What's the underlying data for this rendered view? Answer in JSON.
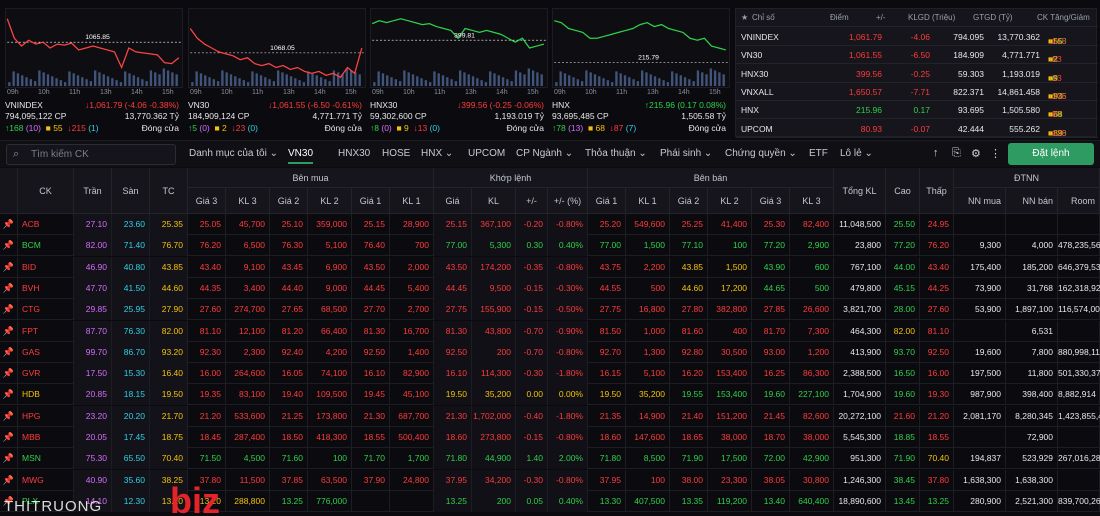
{
  "minis": [
    {
      "name": "VNINDEX",
      "line_color": "#ff4444",
      "ref_label": "1065.85",
      "change": "↓1,061.79 (-4.06 -0.38%)",
      "change_color": "#ff3b3b",
      "vol": "794,095,122 CP",
      "val": "13,770.362 Tỷ",
      "up": "↑168",
      "up_ceil": "(10)",
      "ref_cnt": "55",
      "down": "↓215",
      "down_floor": "(1)",
      "status": "Đóng cửa"
    },
    {
      "name": "VN30",
      "line_color": "#ff4444",
      "ref_label": "1068.05",
      "change": "↓1,061.55 (-6.50 -0.61%)",
      "change_color": "#ff3b3b",
      "vol": "184,909,124 CP",
      "val": "4,771.771 Tỷ",
      "up": "↑5",
      "up_ceil": "(0)",
      "ref_cnt": "2",
      "down": "↓23",
      "down_floor": "(0)",
      "status": "Đóng cửa"
    },
    {
      "name": "HNX30",
      "line_color": "#2fd14b",
      "ref_label": "399.81",
      "change": "↓399.56 (-0.25 -0.06%)",
      "change_color": "#ff3b3b",
      "vol": "59,302,600 CP",
      "val": "1,193.019 Tỷ",
      "up": "↑8",
      "up_ceil": "(0)",
      "ref_cnt": "9",
      "down": "↓13",
      "down_floor": "(0)",
      "status": "Đóng cửa"
    },
    {
      "name": "HNX",
      "line_color": "#2fd14b",
      "ref_label": "215.79",
      "change": "↑215.96 (0.17 0.08%)",
      "change_color": "#2fd14b",
      "vol": "93,695,485 CP",
      "val": "1,505.58 Tỷ",
      "up": "↑78",
      "up_ceil": "(13)",
      "ref_cnt": "68",
      "down": "↓87",
      "down_floor": "(7)",
      "status": "Đóng cửa"
    }
  ],
  "mini_times": [
    "09h",
    "10h",
    "11h",
    "13h",
    "14h",
    "15h"
  ],
  "index_table": {
    "headers": [
      "Chỉ số",
      "Điểm",
      "+/-",
      "KLGD (Triệu)",
      "GTGD (Tỷ)",
      "CK Tăng/Giảm"
    ],
    "rows": [
      {
        "name": "VNINDEX",
        "point": "1,061.79",
        "change": "-4.06",
        "vol": "794.095",
        "val": "13,770.362",
        "up": "↑168",
        "ref": "55",
        "down": "↓215",
        "color": "#ff3b3b"
      },
      {
        "name": "VN30",
        "point": "1,061.55",
        "change": "-6.50",
        "vol": "184.909",
        "val": "4,771.771",
        "up": "↑5",
        "ref": "2",
        "down": "↓23",
        "color": "#ff3b3b"
      },
      {
        "name": "HNX30",
        "point": "399.56",
        "change": "-0.25",
        "vol": "59.303",
        "val": "1,193.019",
        "up": "↑8",
        "ref": "9",
        "down": "↓13",
        "color": "#ff3b3b"
      },
      {
        "name": "VNXALL",
        "point": "1,650.57",
        "change": "-7.71",
        "vol": "822.371",
        "val": "14,861.458",
        "up": "↑175",
        "ref": "93",
        "down": "↓206",
        "color": "#ff3b3b"
      },
      {
        "name": "HNX",
        "point": "215.96",
        "change": "0.17",
        "vol": "93.695",
        "val": "1,505.580",
        "up": "↑78",
        "ref": "68",
        "down": "↓87",
        "color": "#2fd14b"
      },
      {
        "name": "UPCOM",
        "point": "80.93",
        "change": "-0.07",
        "vol": "42.444",
        "val": "555.262",
        "up": "↑128",
        "ref": "89",
        "down": "↓130",
        "color": "#ff3b3b"
      }
    ]
  },
  "toolbar": {
    "search_placeholder": "Tìm kiếm CK",
    "tabs": [
      "Danh mục của tôi",
      "VN30",
      "HNX30",
      "HOSE",
      "HNX",
      "UPCOM",
      "CP Ngành",
      "Thỏa thuận",
      "Phái sinh",
      "Chứng quyền",
      "ETF",
      "Lô lẻ"
    ],
    "order_label": "Đặt lệnh"
  },
  "board": {
    "groups": {
      "buy": "Bên mua",
      "match": "Khớp lệnh",
      "sell": "Bên bán",
      "foreign": "ĐTNN"
    },
    "headers": {
      "ck": "CK",
      "ceil": "Trần",
      "floor": "Sàn",
      "ref": "TC",
      "b3": "Giá 3",
      "bk3": "KL 3",
      "b2": "Giá 2",
      "bk2": "KL 2",
      "b1": "Giá 1",
      "bk1": "KL 1",
      "mp": "Giá",
      "mk": "KL",
      "mc": "+/-",
      "mpct": "+/- (%)",
      "s1": "Giá 1",
      "sk1": "KL 1",
      "s2": "Giá 2",
      "sk2": "KL 2",
      "s3": "Giá 3",
      "sk3": "KL 3",
      "tot": "Tổng KL",
      "hi": "Cao",
      "lo": "Thấp",
      "nnb": "NN mua",
      "nns": "NN bán",
      "room": "Room"
    },
    "rows": [
      {
        "ck": "ACB",
        "ck_c": "#ff3b3b",
        "ceil": "27.10",
        "floor": "23.60",
        "ref": "25.35",
        "b3": "25.05",
        "b3c": "#ff3b3b",
        "bk3": "45,700",
        "b2": "25.10",
        "b2c": "#ff3b3b",
        "bk2": "359,000",
        "b1": "25.15",
        "b1c": "#ff3b3b",
        "bk1": "28,900",
        "mp": "25.15",
        "mpc": "#ff3b3b",
        "mk": "367,100",
        "mc": "-0.20",
        "mpct": "-0.80%",
        "s1": "25.20",
        "s1c": "#ff3b3b",
        "sk1": "549,600",
        "s2": "25.25",
        "s2c": "#ff3b3b",
        "sk2": "41,400",
        "s3": "25.30",
        "s3c": "#ff3b3b",
        "sk3": "82,400",
        "tot": "11,048,500",
        "hi": "25.50",
        "hic": "#2fd14b",
        "lo": "24.95",
        "loc": "#ff3b3b",
        "nnb": "",
        "nns": "",
        "room": ""
      },
      {
        "ck": "BCM",
        "ck_c": "#2fd14b",
        "ceil": "82.00",
        "floor": "71.40",
        "ref": "76.70",
        "b3": "76.20",
        "b3c": "#ff3b3b",
        "bk3": "6,500",
        "b2": "76.30",
        "b2c": "#ff3b3b",
        "bk2": "5,100",
        "b1": "76.40",
        "b1c": "#ff3b3b",
        "bk1": "700",
        "mp": "77.00",
        "mpc": "#2fd14b",
        "mk": "5,300",
        "mc": "0.30",
        "mpct": "0.40%",
        "s1": "77.00",
        "s1c": "#2fd14b",
        "sk1": "1,500",
        "s2": "77.10",
        "s2c": "#2fd14b",
        "sk2": "100",
        "s3": "77.20",
        "s3c": "#2fd14b",
        "sk3": "2,900",
        "tot": "23,800",
        "hi": "77.20",
        "hic": "#2fd14b",
        "lo": "76.20",
        "loc": "#ff3b3b",
        "nnb": "9,300",
        "nns": "4,000",
        "room": "478,235,565"
      },
      {
        "ck": "BID",
        "ck_c": "#ff3b3b",
        "ceil": "46.90",
        "floor": "40.80",
        "ref": "43.85",
        "b3": "43.40",
        "b3c": "#ff3b3b",
        "bk3": "9,100",
        "b2": "43.45",
        "b2c": "#ff3b3b",
        "bk2": "6,900",
        "b1": "43.50",
        "b1c": "#ff3b3b",
        "bk1": "2,000",
        "mp": "43.50",
        "mpc": "#ff3b3b",
        "mk": "174,200",
        "mc": "-0.35",
        "mpct": "-0.80%",
        "s1": "43.75",
        "s1c": "#ff3b3b",
        "sk1": "2,200",
        "s2": "43.85",
        "s2c": "#f4c20d",
        "sk2": "1,500",
        "s3": "43.90",
        "s3c": "#2fd14b",
        "sk3": "600",
        "tot": "767,100",
        "hi": "44.00",
        "hic": "#2fd14b",
        "lo": "43.40",
        "loc": "#ff3b3b",
        "nnb": "175,400",
        "nns": "185,200",
        "room": "646,379,531"
      },
      {
        "ck": "BVH",
        "ck_c": "#ff3b3b",
        "ceil": "47.70",
        "floor": "41.50",
        "ref": "44.60",
        "b3": "44.35",
        "b3c": "#ff3b3b",
        "bk3": "3,400",
        "b2": "44.40",
        "b2c": "#ff3b3b",
        "bk2": "9,000",
        "b1": "44.45",
        "b1c": "#ff3b3b",
        "bk1": "5,400",
        "mp": "44.45",
        "mpc": "#ff3b3b",
        "mk": "9,500",
        "mc": "-0.15",
        "mpct": "-0.30%",
        "s1": "44.55",
        "s1c": "#ff3b3b",
        "sk1": "500",
        "s2": "44.60",
        "s2c": "#f4c20d",
        "sk2": "17,200",
        "s3": "44.65",
        "s3c": "#2fd14b",
        "sk3": "500",
        "tot": "479,800",
        "hi": "45.15",
        "hic": "#2fd14b",
        "lo": "44.25",
        "loc": "#ff3b3b",
        "nnb": "73,900",
        "nns": "31,768",
        "room": "162,318,920"
      },
      {
        "ck": "CTG",
        "ck_c": "#ff3b3b",
        "ceil": "29.85",
        "floor": "25.95",
        "ref": "27.90",
        "b3": "27.60",
        "b3c": "#ff3b3b",
        "bk3": "274,700",
        "b2": "27.65",
        "b2c": "#ff3b3b",
        "bk2": "68,500",
        "b1": "27.70",
        "b1c": "#ff3b3b",
        "bk1": "2,700",
        "mp": "27.75",
        "mpc": "#ff3b3b",
        "mk": "155,900",
        "mc": "-0.15",
        "mpct": "-0.50%",
        "s1": "27.75",
        "s1c": "#ff3b3b",
        "sk1": "16,800",
        "s2": "27.80",
        "s2c": "#ff3b3b",
        "sk2": "382,800",
        "s3": "27.85",
        "s3c": "#ff3b3b",
        "sk3": "26,600",
        "tot": "3,821,700",
        "hi": "28.00",
        "hic": "#2fd14b",
        "lo": "27.60",
        "loc": "#ff3b3b",
        "nnb": "53,900",
        "nns": "1,897,100",
        "room": "116,574,005"
      },
      {
        "ck": "FPT",
        "ck_c": "#ff3b3b",
        "ceil": "87.70",
        "floor": "76.30",
        "ref": "82.00",
        "b3": "81.10",
        "b3c": "#ff3b3b",
        "bk3": "12,100",
        "b2": "81.20",
        "b2c": "#ff3b3b",
        "bk2": "66,400",
        "b1": "81.30",
        "b1c": "#ff3b3b",
        "bk1": "16,700",
        "mp": "81.30",
        "mpc": "#ff3b3b",
        "mk": "43,800",
        "mc": "-0.70",
        "mpct": "-0.90%",
        "s1": "81.50",
        "s1c": "#ff3b3b",
        "sk1": "1,000",
        "s2": "81.60",
        "s2c": "#ff3b3b",
        "sk2": "400",
        "s3": "81.70",
        "s3c": "#ff3b3b",
        "sk3": "7,300",
        "tot": "464,300",
        "hi": "82.00",
        "hic": "#f4c20d",
        "lo": "81.10",
        "loc": "#ff3b3b",
        "nnb": "",
        "nns": "6,531",
        "room": ""
      },
      {
        "ck": "GAS",
        "ck_c": "#ff3b3b",
        "ceil": "99.70",
        "floor": "86.70",
        "ref": "93.20",
        "b3": "92.30",
        "b3c": "#ff3b3b",
        "bk3": "2,300",
        "b2": "92.40",
        "b2c": "#ff3b3b",
        "bk2": "4,200",
        "b1": "92.50",
        "b1c": "#ff3b3b",
        "bk1": "1,400",
        "mp": "92.50",
        "mpc": "#ff3b3b",
        "mk": "200",
        "mc": "-0.70",
        "mpct": "-0.80%",
        "s1": "92.70",
        "s1c": "#ff3b3b",
        "sk1": "1,300",
        "s2": "92.80",
        "s2c": "#ff3b3b",
        "sk2": "30,500",
        "s3": "93.00",
        "s3c": "#ff3b3b",
        "sk3": "1,200",
        "tot": "413,900",
        "hi": "93.70",
        "hic": "#2fd14b",
        "lo": "92.50",
        "loc": "#ff3b3b",
        "nnb": "19,600",
        "nns": "7,800",
        "room": "880,998,111"
      },
      {
        "ck": "GVR",
        "ck_c": "#ff3b3b",
        "ceil": "17.50",
        "floor": "15.30",
        "ref": "16.40",
        "b3": "16.00",
        "b3c": "#ff3b3b",
        "bk3": "264,600",
        "b2": "16.05",
        "b2c": "#ff3b3b",
        "bk2": "74,100",
        "b1": "16.10",
        "b1c": "#ff3b3b",
        "bk1": "82,900",
        "mp": "16.10",
        "mpc": "#ff3b3b",
        "mk": "114,300",
        "mc": "-0.30",
        "mpct": "-1.80%",
        "s1": "16.15",
        "s1c": "#ff3b3b",
        "sk1": "5,100",
        "s2": "16.20",
        "s2c": "#ff3b3b",
        "sk2": "153,400",
        "s3": "16.25",
        "s3c": "#ff3b3b",
        "sk3": "86,300",
        "tot": "2,388,500",
        "hi": "16.50",
        "hic": "#2fd14b",
        "lo": "16.00",
        "loc": "#ff3b3b",
        "nnb": "197,500",
        "nns": "11,800",
        "room": "501,330,375"
      },
      {
        "ck": "HDB",
        "ck_c": "#f4c20d",
        "ceil": "20.85",
        "floor": "18.15",
        "ref": "19.50",
        "b3": "19.35",
        "b3c": "#ff3b3b",
        "bk3": "83,100",
        "b2": "19.40",
        "b2c": "#ff3b3b",
        "bk2": "109,500",
        "b1": "19.45",
        "b1c": "#ff3b3b",
        "bk1": "45,100",
        "mp": "19.50",
        "mpc": "#f4c20d",
        "mk": "35,200",
        "mc": "0.00",
        "mpct": "0.00%",
        "s1": "19.50",
        "s1c": "#f4c20d",
        "sk1": "35,200",
        "s2": "19.55",
        "s2c": "#2fd14b",
        "sk2": "153,400",
        "s3": "19.60",
        "s3c": "#2fd14b",
        "sk3": "227,100",
        "tot": "1,704,900",
        "hi": "19.60",
        "hic": "#2fd14b",
        "lo": "19.30",
        "loc": "#ff3b3b",
        "nnb": "987,900",
        "nns": "398,400",
        "room": "8,882,914"
      },
      {
        "ck": "HPG",
        "ck_c": "#ff3b3b",
        "ceil": "23.20",
        "floor": "20.20",
        "ref": "21.70",
        "b3": "21.20",
        "b3c": "#ff3b3b",
        "bk3": "533,600",
        "b2": "21.25",
        "b2c": "#ff3b3b",
        "bk2": "173,800",
        "b1": "21.30",
        "b1c": "#ff3b3b",
        "bk1": "687,700",
        "mp": "21.30",
        "mpc": "#ff3b3b",
        "mk": "1,702,000",
        "mc": "-0.40",
        "mpct": "-1.80%",
        "s1": "21.35",
        "s1c": "#ff3b3b",
        "sk1": "14,900",
        "s2": "21.40",
        "s2c": "#ff3b3b",
        "sk2": "151,200",
        "s3": "21.45",
        "s3c": "#ff3b3b",
        "sk3": "82,600",
        "tot": "20,272,100",
        "hi": "21.60",
        "hic": "#ff3b3b",
        "lo": "21.20",
        "loc": "#ff3b3b",
        "nnb": "2,081,170",
        "nns": "8,280,345",
        "room": "1,423,855,471"
      },
      {
        "ck": "MBB",
        "ck_c": "#ff3b3b",
        "ceil": "20.05",
        "floor": "17.45",
        "ref": "18.75",
        "b3": "18.45",
        "b3c": "#ff3b3b",
        "bk3": "287,400",
        "b2": "18.50",
        "b2c": "#ff3b3b",
        "bk2": "418,300",
        "b1": "18.55",
        "b1c": "#ff3b3b",
        "bk1": "500,400",
        "mp": "18.60",
        "mpc": "#ff3b3b",
        "mk": "273,800",
        "mc": "-0.15",
        "mpct": "-0.80%",
        "s1": "18.60",
        "s1c": "#ff3b3b",
        "sk1": "147,600",
        "s2": "18.65",
        "s2c": "#ff3b3b",
        "sk2": "38,000",
        "s3": "18.70",
        "s3c": "#ff3b3b",
        "sk3": "38,000",
        "tot": "5,545,300",
        "hi": "18.85",
        "hic": "#2fd14b",
        "lo": "18.55",
        "loc": "#ff3b3b",
        "nnb": "",
        "nns": "72,900",
        "room": ""
      },
      {
        "ck": "MSN",
        "ck_c": "#2fd14b",
        "ceil": "75.30",
        "floor": "65.50",
        "ref": "70.40",
        "b3": "71.50",
        "b3c": "#2fd14b",
        "bk3": "4,500",
        "b2": "71.60",
        "b2c": "#2fd14b",
        "bk2": "100",
        "b1": "71.70",
        "b1c": "#2fd14b",
        "bk1": "1,700",
        "mp": "71.80",
        "mpc": "#2fd14b",
        "mk": "44,900",
        "mc": "1.40",
        "mpct": "2.00%",
        "s1": "71.80",
        "s1c": "#2fd14b",
        "sk1": "8,500",
        "s2": "71.90",
        "s2c": "#2fd14b",
        "sk2": "17,500",
        "s3": "72.00",
        "s3c": "#2fd14b",
        "sk3": "42,900",
        "tot": "951,300",
        "hi": "71.90",
        "hic": "#2fd14b",
        "lo": "70.40",
        "loc": "#f4c20d",
        "nnb": "194,837",
        "nns": "523,929",
        "room": "267,016,285"
      },
      {
        "ck": "MWG",
        "ck_c": "#ff3b3b",
        "ceil": "40.90",
        "floor": "35.60",
        "ref": "38.25",
        "b3": "37.80",
        "b3c": "#ff3b3b",
        "bk3": "11,500",
        "b2": "37.85",
        "b2c": "#ff3b3b",
        "bk2": "63,500",
        "b1": "37.90",
        "b1c": "#ff3b3b",
        "bk1": "24,800",
        "mp": "37.95",
        "mpc": "#ff3b3b",
        "mk": "34,200",
        "mc": "-0.30",
        "mpct": "-0.80%",
        "s1": "37.95",
        "s1c": "#ff3b3b",
        "sk1": "100",
        "s2": "38.00",
        "s2c": "#ff3b3b",
        "sk2": "23,300",
        "s3": "38.05",
        "s3c": "#ff3b3b",
        "sk3": "30,800",
        "tot": "1,246,300",
        "hi": "38.45",
        "hic": "#2fd14b",
        "lo": "37.80",
        "loc": "#ff3b3b",
        "nnb": "1,638,300",
        "nns": "1,638,300",
        "room": ""
      },
      {
        "ck": "PLX",
        "ck_c": "#2fd14b",
        "ceil": "14.10",
        "floor": "12.30",
        "ref": "13.20",
        "b3": "13.20",
        "b3c": "#f4c20d",
        "bk3": "288,800",
        "b2": "13.25",
        "b2c": "#2fd14b",
        "bk2": "776,000",
        "b1": "",
        "b1c": "#2fd14b",
        "bk1": "",
        "mp": "13.25",
        "mpc": "#2fd14b",
        "mk": "200",
        "mc": "0.05",
        "mpct": "0.40%",
        "s1": "13.30",
        "s1c": "#2fd14b",
        "sk1": "407,500",
        "s2": "13.35",
        "s2c": "#2fd14b",
        "sk2": "119,200",
        "s3": "13.40",
        "s3c": "#2fd14b",
        "sk3": "640,400",
        "tot": "18,890,600",
        "hi": "13.45",
        "hic": "#2fd14b",
        "lo": "13.25",
        "loc": "#2fd14b",
        "nnb": "280,900",
        "nns": "2,521,300",
        "room": "839,700,269"
      }
    ]
  },
  "watermark": {
    "left": "THITRUONG",
    "right": "biz"
  }
}
